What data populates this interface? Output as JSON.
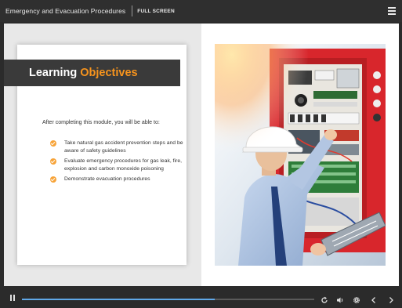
{
  "header": {
    "course_title": "Emergency and Evacuation Procedures",
    "fullscreen_label": "FULL SCREEN"
  },
  "slide": {
    "title_part1": "Learning",
    "title_part2": "Objectives",
    "intro": "After completing this module, you will be able to:",
    "objectives": [
      "Take natural gas accident prevention steps and be aware of safety guidelines",
      "Evaluate emergency procedures for gas leak, fire, explosion and carbon monoxide poisoning",
      "Demonstrate evacuation procedures"
    ],
    "image_subject": "engineer-checking-electrical-panel"
  },
  "player": {
    "progress": 0.66
  },
  "colors": {
    "accent": "#f7941d",
    "banner": "#3a3a3a",
    "progress": "#60a8e8",
    "chrome": "#2b2b2b"
  },
  "icons": [
    "menu-icon",
    "pause-icon",
    "replay-icon",
    "volume-icon",
    "gear-icon",
    "chevron-left-icon",
    "chevron-right-icon",
    "check-icon"
  ]
}
